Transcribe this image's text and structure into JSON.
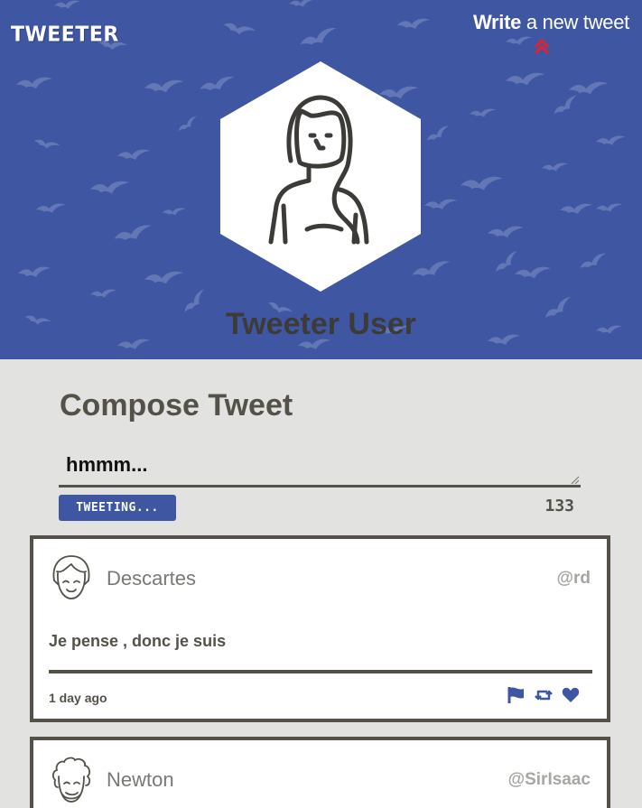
{
  "header": {
    "logo": "TWEETER",
    "write_bold": "Write",
    "write_rest": " a new tweet",
    "write_arrow_icon": "double-chevron-up-icon",
    "user_name": "Tweeter User",
    "avatar_icon": "woman-avatar-icon",
    "background_color": "#3f57a3",
    "arrow_color": "#e8202a"
  },
  "compose": {
    "title": "Compose Tweet",
    "input_value": "hmmm...",
    "button_label": "TWEETING...",
    "counter": "133"
  },
  "tweets": [
    {
      "name": "Descartes",
      "handle": "@rd",
      "avatar_icon": "girl-avatar-icon",
      "text": "Je pense , donc je suis",
      "time": "1 day ago",
      "actions": [
        "flag-icon",
        "retweet-icon",
        "heart-icon"
      ]
    },
    {
      "name": "Newton",
      "handle": "@SirIsaac",
      "avatar_icon": "curly-hair-avatar-icon"
    }
  ],
  "colors": {
    "accent": "#3f57a3",
    "text_dark": "#545149",
    "page_bg": "#e2e2e0"
  }
}
